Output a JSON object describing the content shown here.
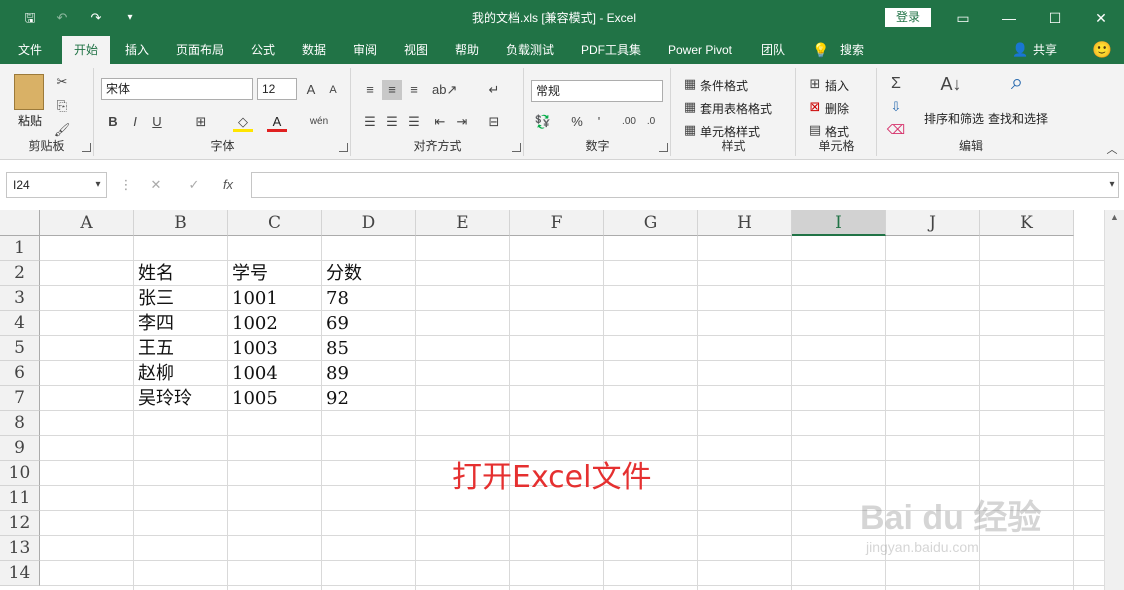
{
  "window": {
    "title": "我的文档.xls  [兼容模式]  -  Excel",
    "login_label": "登录"
  },
  "tabs": [
    "文件",
    "开始",
    "插入",
    "页面布局",
    "公式",
    "数据",
    "审阅",
    "视图",
    "帮助",
    "负载测试",
    "PDF工具集",
    "Power Pivot",
    "团队",
    "搜索"
  ],
  "share_label": "共享",
  "ribbon": {
    "clipboard": {
      "paste": "粘贴",
      "label": "剪贴板"
    },
    "font": {
      "name": "宋体",
      "size": "12",
      "label": "字体",
      "bold": "B",
      "italic": "I",
      "underline": "U"
    },
    "alignment": {
      "label": "对齐方式"
    },
    "number": {
      "format": "常规",
      "label": "数字",
      "percent": "%",
      "comma": "'"
    },
    "styles": {
      "conditional": "条件格式",
      "table": "套用表格格式",
      "cell": "单元格样式",
      "label": "样式"
    },
    "cells": {
      "insert": "插入",
      "delete": "删除",
      "format": "格式",
      "label": "单元格"
    },
    "editing": {
      "sort": "排序和筛选",
      "find": "查找和选择",
      "label": "编辑"
    }
  },
  "formula_bar": {
    "name_box": "I24",
    "fx": "fx",
    "value": ""
  },
  "columns": [
    "A",
    "B",
    "C",
    "D",
    "E",
    "F",
    "G",
    "H",
    "I",
    "J",
    "K"
  ],
  "selected_column": "I",
  "rows": [
    "1",
    "2",
    "3",
    "4",
    "5",
    "6",
    "7",
    "8",
    "9",
    "10",
    "11",
    "12",
    "13",
    "14"
  ],
  "sheet": {
    "headers": [
      "姓名",
      "学号",
      "分数"
    ],
    "records": [
      [
        "张三",
        "1001",
        "78"
      ],
      [
        "李四",
        "1002",
        "69"
      ],
      [
        "王五",
        "1003",
        "85"
      ],
      [
        "赵柳",
        "1004",
        "89"
      ],
      [
        "吴玲玲",
        "1005",
        "92"
      ]
    ]
  },
  "annotation": "打开Excel文件",
  "watermark": {
    "brand": "Bai du 经验",
    "url": "jingyan.baidu.com"
  },
  "colors": {
    "excel_green": "#217346",
    "annotation_red": "#e53030"
  }
}
